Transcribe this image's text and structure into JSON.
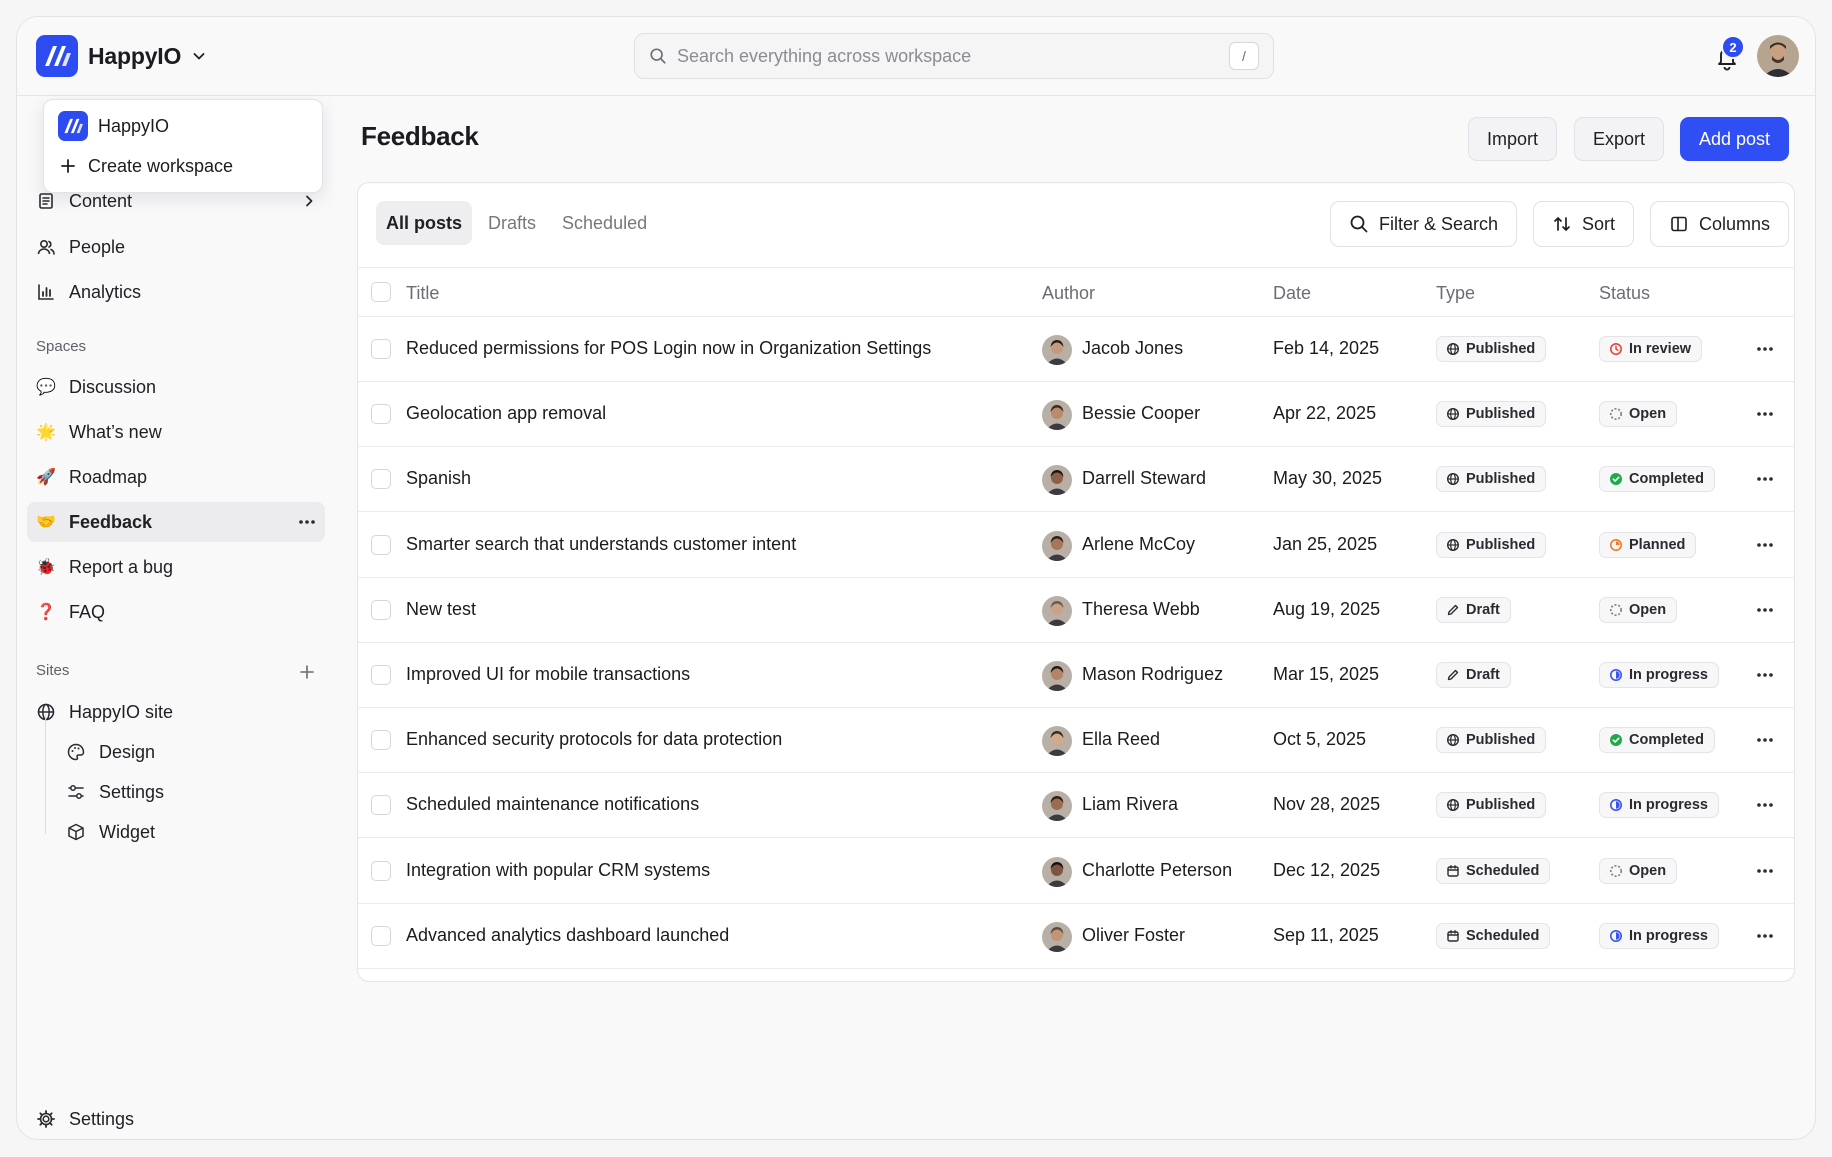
{
  "workspace": {
    "name": "HappyIO"
  },
  "search": {
    "placeholder": "Search everything across workspace",
    "shortcut": "/"
  },
  "notifications": {
    "count": "2"
  },
  "dropdown": {
    "items": [
      {
        "label": "HappyIO"
      },
      {
        "label": "Create workspace"
      }
    ]
  },
  "sidebar": {
    "nav": [
      {
        "label": "Content",
        "icon": "document-icon"
      },
      {
        "label": "People",
        "icon": "people-icon"
      },
      {
        "label": "Analytics",
        "icon": "bar-chart-icon"
      }
    ],
    "spaces_label": "Spaces",
    "spaces": [
      {
        "label": "Discussion",
        "icon": "💬"
      },
      {
        "label": "What’s new",
        "icon": "🌟"
      },
      {
        "label": "Roadmap",
        "icon": "🚀"
      },
      {
        "label": "Feedback",
        "icon": "🤝"
      },
      {
        "label": "Report a bug",
        "icon": "🐞"
      },
      {
        "label": "FAQ",
        "icon": "❓"
      }
    ],
    "sites_label": "Sites",
    "sites": [
      {
        "label": "HappyIO site"
      },
      {
        "label": "Design"
      },
      {
        "label": "Settings"
      },
      {
        "label": "Widget"
      }
    ],
    "settings_label": "Settings"
  },
  "page": {
    "title": "Feedback"
  },
  "actions": {
    "import": "Import",
    "export": "Export",
    "add": "Add post"
  },
  "tabs": [
    {
      "label": "All posts"
    },
    {
      "label": "Drafts"
    },
    {
      "label": "Scheduled"
    }
  ],
  "tools": {
    "filter": "Filter & Search",
    "sort": "Sort",
    "columns": "Columns"
  },
  "table": {
    "headers": {
      "title": "Title",
      "author": "Author",
      "date": "Date",
      "type": "Type",
      "status": "Status"
    },
    "rows": [
      {
        "title": "Reduced permissions for POS Login now in Organization Settings",
        "author": "Jacob Jones",
        "date": "Feb 14, 2025",
        "type": "Published",
        "status": "In review"
      },
      {
        "title": "Geolocation app removal",
        "author": "Bessie Cooper",
        "date": "Apr 22, 2025",
        "type": "Published",
        "status": "Open"
      },
      {
        "title": "Spanish",
        "author": "Darrell Steward",
        "date": "May 30, 2025",
        "type": "Published",
        "status": "Completed"
      },
      {
        "title": "Smarter search that understands customer intent",
        "author": "Arlene McCoy",
        "date": "Jan 25, 2025",
        "type": "Published",
        "status": "Planned"
      },
      {
        "title": "New test",
        "author": "Theresa Webb",
        "date": "Aug 19, 2025",
        "type": "Draft",
        "status": "Open"
      },
      {
        "title": "Improved UI for mobile transactions",
        "author": "Mason Rodriguez",
        "date": "Mar 15, 2025",
        "type": "Draft",
        "status": "In progress"
      },
      {
        "title": "Enhanced security protocols for data protection",
        "author": "Ella Reed",
        "date": "Oct 5, 2025",
        "type": "Published",
        "status": "Completed"
      },
      {
        "title": "Scheduled maintenance notifications",
        "author": "Liam Rivera",
        "date": "Nov 28, 2025",
        "type": "Published",
        "status": "In progress"
      },
      {
        "title": "Integration with popular CRM systems",
        "author": "Charlotte Peterson",
        "date": "Dec 12, 2025",
        "type": "Scheduled",
        "status": "Open"
      },
      {
        "title": "Advanced analytics dashboard launched",
        "author": "Oliver Foster",
        "date": "Sep 11, 2025",
        "type": "Scheduled",
        "status": "In progress"
      }
    ]
  },
  "colors": {
    "accent": "#2f4ef3",
    "completed": "#1faa4b",
    "in_review": "#e5483a",
    "planned": "#f07a2a",
    "in_progress": "#3a55f0"
  }
}
